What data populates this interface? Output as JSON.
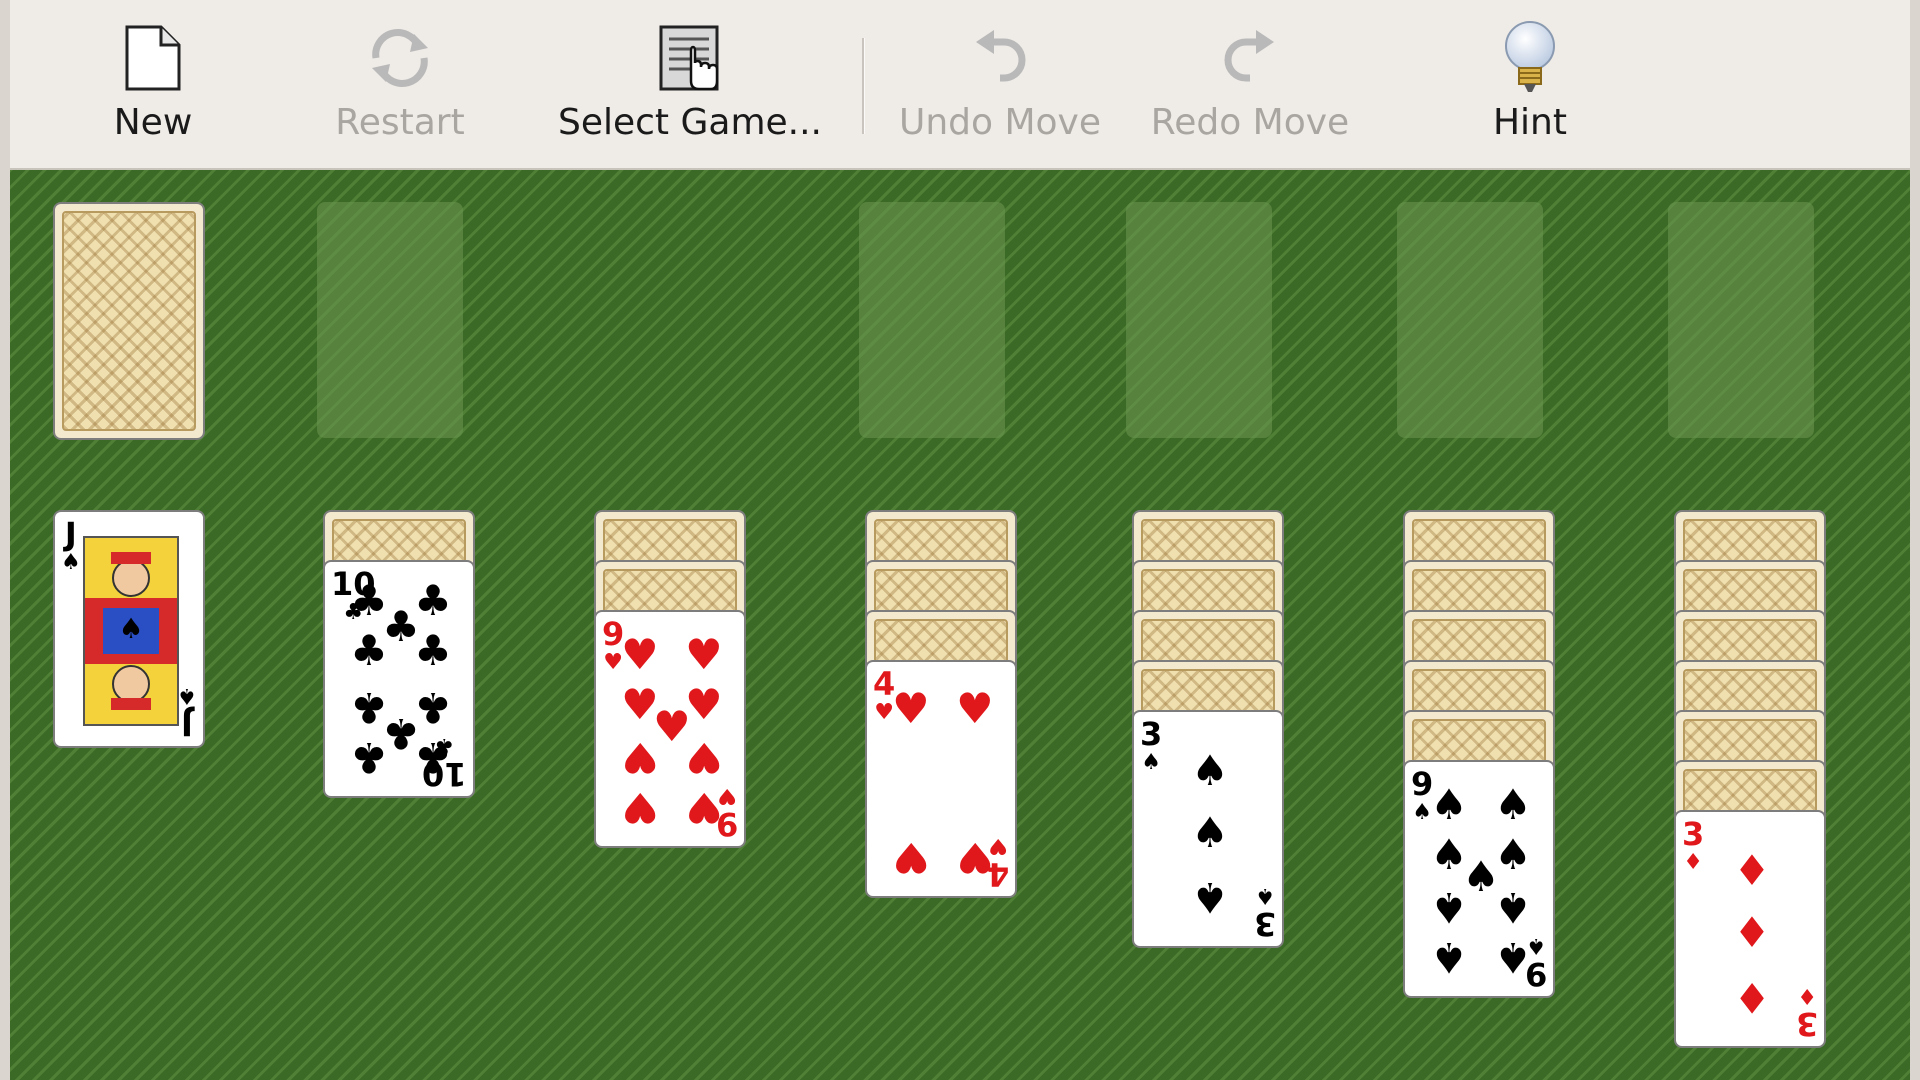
{
  "toolbar": {
    "new": {
      "label": "New",
      "icon": "new-document-icon",
      "enabled": true
    },
    "restart": {
      "label": "Restart",
      "icon": "restart-icon",
      "enabled": false
    },
    "select_game": {
      "label": "Select Game...",
      "icon": "select-game-icon",
      "enabled": true
    },
    "undo": {
      "label": "Undo Move",
      "icon": "undo-icon",
      "enabled": false
    },
    "redo": {
      "label": "Redo Move",
      "icon": "redo-icon",
      "enabled": false
    },
    "hint": {
      "label": "Hint",
      "icon": "lightbulb-icon",
      "enabled": true
    }
  },
  "colors": {
    "felt": "#3d6b28",
    "toolbar": "#efebe7",
    "red_suit": "#e0181b",
    "black_suit": "#000000"
  },
  "game": {
    "stock": {
      "face_down": true
    },
    "waste": {
      "empty": true
    },
    "foundations": [
      {
        "empty": true
      },
      {
        "empty": true
      },
      {
        "empty": true
      },
      {
        "empty": true
      }
    ],
    "tableau": [
      {
        "face_down": 0,
        "top": {
          "rank": "J",
          "suit": "♠",
          "color": "black"
        }
      },
      {
        "face_down": 1,
        "top": {
          "rank": "10",
          "suit": "♣",
          "color": "black"
        }
      },
      {
        "face_down": 2,
        "top": {
          "rank": "9",
          "suit": "♥",
          "color": "red"
        }
      },
      {
        "face_down": 3,
        "top": {
          "rank": "4",
          "suit": "♥",
          "color": "red"
        }
      },
      {
        "face_down": 4,
        "top": {
          "rank": "3",
          "suit": "♠",
          "color": "black"
        }
      },
      {
        "face_down": 5,
        "top": {
          "rank": "9",
          "suit": "♠",
          "color": "black"
        }
      },
      {
        "face_down": 6,
        "top": {
          "rank": "3",
          "suit": "♦",
          "color": "red"
        }
      }
    ]
  }
}
